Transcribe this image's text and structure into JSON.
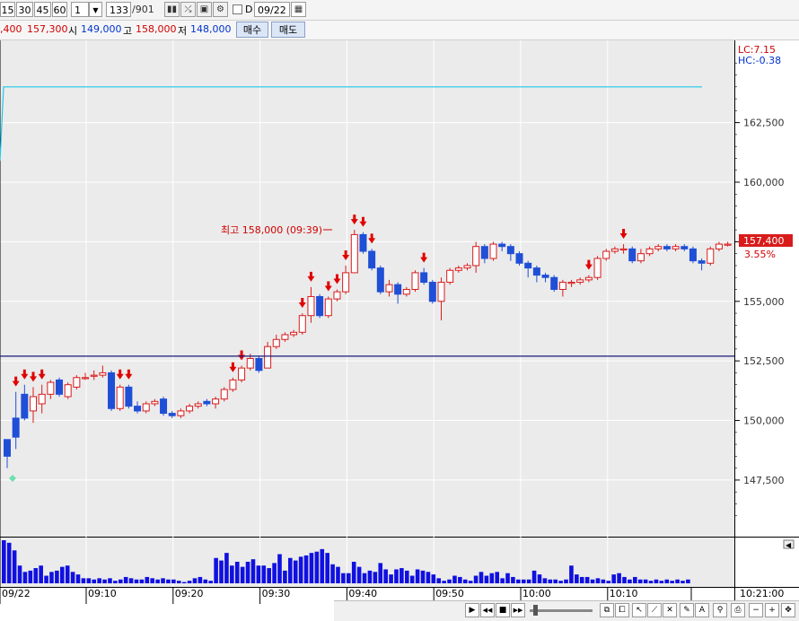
{
  "toolbar": {
    "periods": [
      "15",
      "30",
      "45",
      "60"
    ],
    "interval": "1",
    "count": "133",
    "total": "/901",
    "date": "09/22",
    "d_label": "D"
  },
  "pricebar": {
    "current": ",400",
    "close": "157,300",
    "open_label": "시",
    "open": "149,000",
    "high_label": "고",
    "high": "158,000",
    "low_label": "저",
    "low": "148,000",
    "buy_label": "매수",
    "sell_label": "매도"
  },
  "chart": {
    "lc": "LC:7.15",
    "hc": "HC:-0.38",
    "price_tag": "157,400",
    "pct_tag": "3.55%",
    "high_annotation": "최고 158,000 (09:39)",
    "date_corner": "09/22",
    "time_corner": "10:21:00",
    "colors": {
      "up": "#d81c1c",
      "down": "#1f4fd6",
      "volume": "#1010e0",
      "arrow": "#e00000",
      "line": "#1ec8e8",
      "hline": "#1a1a7a",
      "background": "#ebebeb"
    }
  },
  "chart_data": {
    "type": "candlestick",
    "y_ticks": [
      "162,500",
      "160,000",
      "157,500",
      "155,000",
      "152,500",
      "150,000",
      "147,500"
    ],
    "x_ticks": [
      "09:10",
      "09:20",
      "09:30",
      "09:40",
      "09:50",
      "10:00",
      "10:10"
    ],
    "ylim": [
      145200,
      165800
    ],
    "reference_line": 152700,
    "ma_line_level": 164000,
    "candles": [
      [
        149200,
        148500,
        149200,
        148000
      ],
      [
        150100,
        149300,
        151200,
        148800
      ],
      [
        151100,
        150100,
        151500,
        150000
      ],
      [
        150400,
        151000,
        151400,
        149900
      ],
      [
        150700,
        151100,
        151500,
        150300
      ],
      [
        151100,
        151600,
        151700,
        150900
      ],
      [
        151700,
        151100,
        151800,
        151000
      ],
      [
        151000,
        151500,
        151600,
        150900
      ],
      [
        151400,
        151800,
        151900,
        151300
      ],
      [
        151800,
        151800,
        152000,
        151700
      ],
      [
        151900,
        151900,
        152100,
        151700
      ],
      [
        151900,
        152000,
        152300,
        151800
      ],
      [
        152000,
        150500,
        152100,
        150400
      ],
      [
        150500,
        151400,
        151500,
        150400
      ],
      [
        151400,
        150600,
        151500,
        150500
      ],
      [
        150600,
        150400,
        150800,
        150300
      ],
      [
        150400,
        150700,
        150800,
        150300
      ],
      [
        150700,
        150800,
        150900,
        150600
      ],
      [
        150900,
        150300,
        151000,
        150200
      ],
      [
        150300,
        150200,
        150400,
        150100
      ],
      [
        150200,
        150400,
        150500,
        150100
      ],
      [
        150400,
        150600,
        150700,
        150300
      ],
      [
        150600,
        150700,
        150800,
        150500
      ],
      [
        150800,
        150700,
        150900,
        150600
      ],
      [
        150700,
        150900,
        151000,
        150500
      ],
      [
        150900,
        151300,
        151400,
        150800
      ],
      [
        151300,
        151700,
        151800,
        151200
      ],
      [
        151700,
        152200,
        152300,
        151600
      ],
      [
        152200,
        152600,
        152800,
        152100
      ],
      [
        152600,
        152100,
        152700,
        152000
      ],
      [
        152200,
        153100,
        153300,
        152200
      ],
      [
        153100,
        153400,
        153600,
        153000
      ],
      [
        153400,
        153600,
        153700,
        153300
      ],
      [
        153600,
        153700,
        153800,
        153500
      ],
      [
        153700,
        154400,
        154500,
        153600
      ],
      [
        154400,
        155200,
        155600,
        154100
      ],
      [
        155200,
        154400,
        155300,
        154300
      ],
      [
        154400,
        155100,
        155200,
        154300
      ],
      [
        155100,
        155400,
        155500,
        155000
      ],
      [
        155400,
        156200,
        156500,
        155300
      ],
      [
        156200,
        157800,
        158000,
        156200
      ],
      [
        157800,
        157100,
        157900,
        157000
      ],
      [
        157100,
        156400,
        157200,
        156300
      ],
      [
        156400,
        155400,
        156500,
        155300
      ],
      [
        155400,
        155700,
        155900,
        155200
      ],
      [
        155700,
        155300,
        155800,
        154900
      ],
      [
        155300,
        155500,
        155600,
        155200
      ],
      [
        155500,
        156200,
        156300,
        155400
      ],
      [
        156200,
        155800,
        156400,
        155700
      ],
      [
        155800,
        155000,
        155900,
        154900
      ],
      [
        155000,
        155800,
        156000,
        154200
      ],
      [
        155800,
        156300,
        156400,
        155700
      ],
      [
        156300,
        156400,
        156500,
        156200
      ],
      [
        156400,
        156500,
        156600,
        156300
      ],
      [
        156500,
        157300,
        157500,
        156200
      ],
      [
        157300,
        156800,
        157400,
        156600
      ],
      [
        156800,
        157400,
        157500,
        156700
      ],
      [
        157400,
        157300,
        157500,
        157100
      ],
      [
        157300,
        157000,
        157400,
        156700
      ],
      [
        157000,
        156600,
        157100,
        156500
      ],
      [
        156600,
        156400,
        156700,
        156000
      ],
      [
        156400,
        156100,
        156500,
        155800
      ],
      [
        156100,
        156000,
        156200,
        155800
      ],
      [
        156000,
        155500,
        156100,
        155400
      ],
      [
        155500,
        155800,
        155900,
        155200
      ],
      [
        155800,
        155800,
        155900,
        155600
      ],
      [
        155800,
        155900,
        156000,
        155700
      ],
      [
        155900,
        156000,
        156100,
        155800
      ],
      [
        156000,
        156800,
        156900,
        155900
      ],
      [
        156800,
        157100,
        157200,
        156700
      ],
      [
        157100,
        157200,
        157300,
        157000
      ],
      [
        157200,
        157200,
        157400,
        157000
      ],
      [
        157200,
        156700,
        157300,
        156600
      ],
      [
        156700,
        157000,
        157200,
        156600
      ],
      [
        157000,
        157200,
        157300,
        156900
      ],
      [
        157200,
        157300,
        157400,
        157100
      ],
      [
        157300,
        157200,
        157400,
        157100
      ],
      [
        157200,
        157300,
        157400,
        157100
      ],
      [
        157300,
        157200,
        157400,
        157100
      ],
      [
        157200,
        156700,
        157300,
        156600
      ],
      [
        156700,
        156600,
        156800,
        156300
      ],
      [
        156600,
        157200,
        157300,
        156500
      ],
      [
        157200,
        157400,
        157500,
        157100
      ],
      [
        157400,
        157400,
        157500,
        157300
      ]
    ],
    "volume": [
      34,
      32,
      26,
      14,
      9,
      10,
      12,
      14,
      6,
      9,
      10,
      13,
      14,
      9,
      7,
      4,
      4,
      3,
      4,
      3,
      4,
      2,
      3,
      5,
      4,
      3,
      3,
      5,
      4,
      3,
      4,
      3,
      3,
      2,
      1,
      2,
      4,
      5,
      3,
      2,
      20,
      18,
      24,
      14,
      17,
      13,
      17,
      19,
      14,
      14,
      12,
      16,
      23,
      10,
      20,
      18,
      21,
      22,
      24,
      25,
      27,
      24,
      15,
      13,
      8,
      8,
      17,
      13,
      8,
      10,
      9,
      16,
      11,
      7,
      11,
      12,
      10,
      6,
      11,
      10,
      9,
      7,
      4,
      2,
      3,
      6,
      5,
      3,
      2,
      6,
      9,
      6,
      8,
      9,
      4,
      8,
      5,
      3,
      3,
      3,
      10,
      7,
      4,
      3,
      3,
      2,
      3,
      14,
      7,
      5,
      5,
      3,
      4,
      3,
      2,
      7,
      8,
      5,
      3,
      5,
      3,
      3,
      2,
      3,
      2,
      3,
      2,
      3,
      2,
      3
    ],
    "arrows": [
      1,
      2,
      3,
      4,
      13,
      14,
      26,
      27,
      34,
      35,
      37,
      38,
      39,
      40,
      41,
      42,
      48,
      67,
      71
    ],
    "legend": ""
  },
  "nav": {
    "play": "▶",
    "back": "◀◀",
    "stop": "■",
    "fwd": "▶▶",
    "minus": "−",
    "plus": "+"
  }
}
